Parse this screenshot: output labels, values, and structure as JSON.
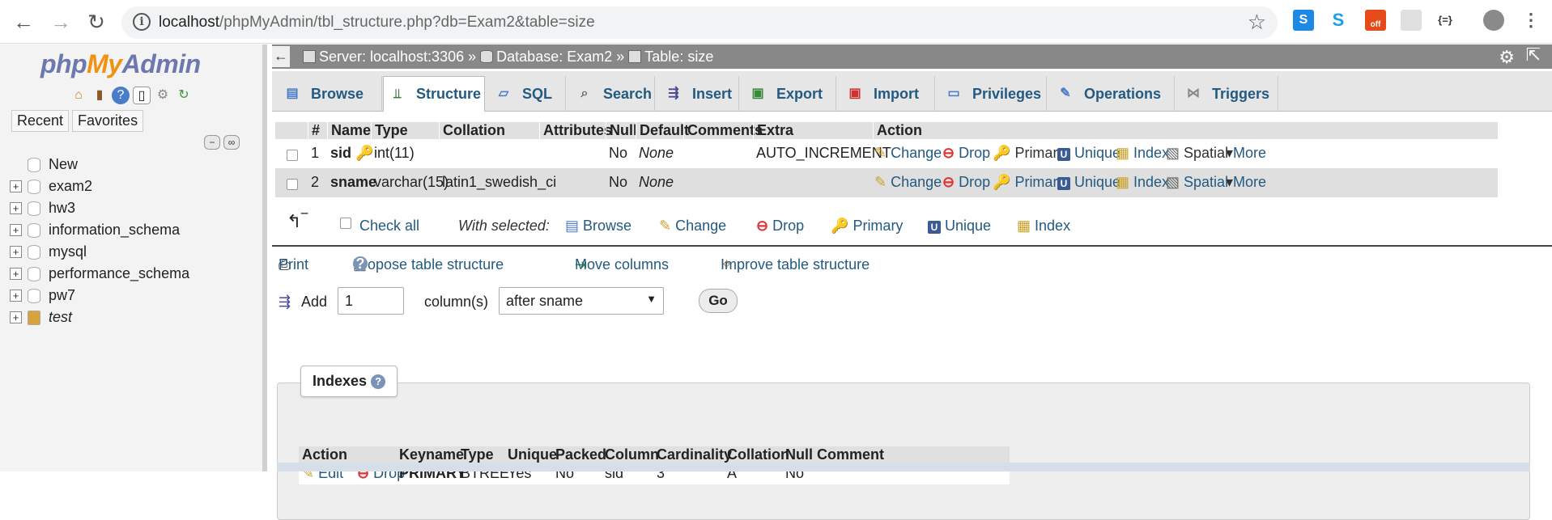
{
  "browser": {
    "url_host": "localhost",
    "url_path": "/phpMyAdmin/tbl_structure.php?db=Exam2&table=size",
    "extensions": [
      "S",
      "S",
      "off",
      "",
      "{=}"
    ]
  },
  "sidebar": {
    "logo": {
      "php": "php",
      "my": "My",
      "admin": "Admin"
    },
    "tabs": [
      "Recent",
      "Favorites"
    ],
    "tree": [
      {
        "label": "New",
        "expandable": false
      },
      {
        "label": "exam2",
        "expandable": true
      },
      {
        "label": "hw3",
        "expandable": true
      },
      {
        "label": "information_schema",
        "expandable": true
      },
      {
        "label": "mysql",
        "expandable": true
      },
      {
        "label": "performance_schema",
        "expandable": true
      },
      {
        "label": "pw7",
        "expandable": true
      },
      {
        "label": "test",
        "expandable": true,
        "italic": true
      }
    ]
  },
  "breadcrumb": {
    "server": "Server: localhost:3306",
    "database": "Database: Exam2",
    "table": "Table: size",
    "sep": "»"
  },
  "tabs": [
    "Browse",
    "Structure",
    "SQL",
    "Search",
    "Insert",
    "Export",
    "Import",
    "Privileges",
    "Operations",
    "Triggers"
  ],
  "active_tab": "Structure",
  "structure": {
    "headers": [
      "#",
      "Name",
      "Type",
      "Collation",
      "Attributes",
      "Null",
      "Default",
      "Comments",
      "Extra",
      "Action"
    ],
    "rows": [
      {
        "num": "1",
        "name": "sid",
        "type": "int(11)",
        "collation": "",
        "attributes": "",
        "null": "No",
        "default": "None",
        "comments": "",
        "extra": "AUTO_INCREMENT"
      },
      {
        "num": "2",
        "name": "sname",
        "type": "varchar(15)",
        "collation": "latin1_swedish_ci",
        "attributes": "",
        "null": "No",
        "default": "None",
        "comments": "",
        "extra": ""
      }
    ],
    "row_actions": [
      "Change",
      "Drop",
      "Primary",
      "Unique",
      "Index",
      "Spatial",
      "More"
    ]
  },
  "bulk": {
    "check_all": "Check all",
    "with_selected": "With selected:",
    "actions": [
      "Browse",
      "Change",
      "Drop",
      "Primary",
      "Unique",
      "Index"
    ]
  },
  "links": {
    "print": "Print",
    "propose": "Propose table structure",
    "move": "Move columns",
    "improve": "Improve table structure"
  },
  "add_column": {
    "label": "Add",
    "count": "1",
    "unit": "column(s)",
    "position": "after sname",
    "go": "Go"
  },
  "indexes": {
    "legend": "Indexes",
    "headers": [
      "Action",
      "Keyname",
      "Type",
      "Unique",
      "Packed",
      "Column",
      "Cardinality",
      "Collation",
      "Null",
      "Comment"
    ],
    "rows": [
      {
        "edit": "Edit",
        "drop": "Drop",
        "keyname": "PRIMARY",
        "type": "BTREE",
        "unique": "Yes",
        "packed": "No",
        "column": "sid",
        "cardinality": "3",
        "collation": "A",
        "null": "No",
        "comment": ""
      }
    ]
  }
}
